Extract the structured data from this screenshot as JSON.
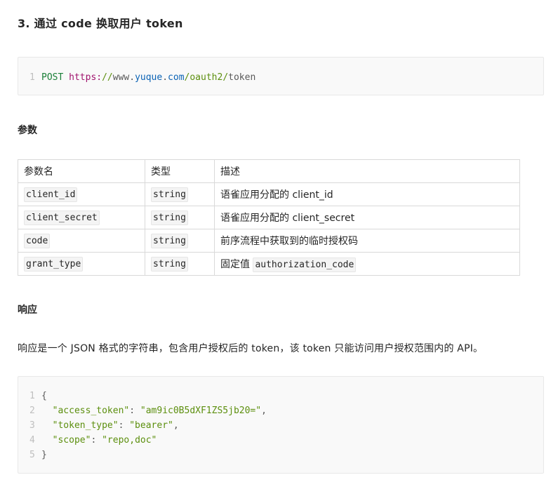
{
  "section_title": "3. 通过 code 换取用户 token",
  "request_code": {
    "line_number": "1",
    "method": "POST",
    "protocol": "https:",
    "slashes": "//",
    "www": "www.",
    "domain": "yuque",
    "dot": ".",
    "tld": "com",
    "path": "/oauth2/",
    "endpoint": "token"
  },
  "params_heading": "参数",
  "params_table": {
    "headers": [
      "参数名",
      "类型",
      "描述"
    ],
    "rows": [
      {
        "name": "client_id",
        "type": "string",
        "desc": "语雀应用分配的 client_id",
        "desc_code": ""
      },
      {
        "name": "client_secret",
        "type": "string",
        "desc": "语雀应用分配的 client_secret",
        "desc_code": ""
      },
      {
        "name": "code",
        "type": "string",
        "desc": "前序流程中获取到的临时授权码",
        "desc_code": ""
      },
      {
        "name": "grant_type",
        "type": "string",
        "desc": "固定值 ",
        "desc_code": "authorization_code"
      }
    ]
  },
  "response_heading": "响应",
  "response_text": "响应是一个 JSON 格式的字符串，包含用户授权后的 token，该 token 只能访问用户授权范围内的 API。",
  "response_code": {
    "line_numbers": [
      "1",
      "2",
      "3",
      "4",
      "5"
    ],
    "open_brace": "{",
    "close_brace": "}",
    "fields": [
      {
        "key": "\"access_token\"",
        "sep": ": ",
        "value": "\"am9ic0B5dXF1ZS5jb20=\"",
        "trail": ","
      },
      {
        "key": "\"token_type\"",
        "sep": ": ",
        "value": "\"bearer\"",
        "trail": ","
      },
      {
        "key": "\"scope\"",
        "sep": ": ",
        "value": "\"repo,doc\"",
        "trail": ""
      }
    ]
  }
}
